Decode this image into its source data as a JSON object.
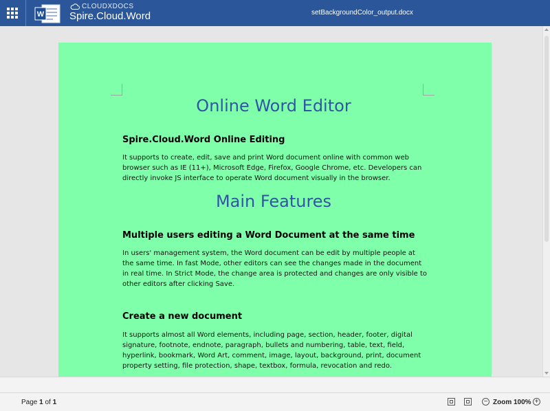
{
  "header": {
    "brand_top": "CLOUDXDOCS",
    "brand_main": "Spire.Cloud.Word",
    "file_name": "setBackgroundColor_output.docx",
    "bg_color": "#2b579a"
  },
  "page": {
    "background_color": "#80ffaa"
  },
  "document": {
    "title": "Online Word Editor",
    "section1_heading": "Spire.Cloud.Word Online Editing",
    "section1_text": "It supports to create, edit, save and print Word document online with common web browser such as IE (11+), Microsoft Edge, Firefox, Google Chrome, etc. Developers can directly invoke JS interface to operate Word document visually in the browser.",
    "features_title": "Main Features",
    "feature1_heading": "Multiple users editing a Word Document at the same time",
    "feature1_text": "In users' management system, the Word document can be edit by multiple people at the same time. In fast Mode, other editors can see the changes made in the document in real time. In Strict Mode, the change area is protected and changes are only visible to other editors after clicking Save.",
    "feature2_heading": "Create a new document",
    "feature2_text": "It supports almost all Word elements, including page, section, header, footer, digital signature, footnote, endnote, paragraph, bullets and numbering, table, text, field, hyperlink, bookmark, Word Art, comment, image, layout, background, print, document property setting, file protection, shape, textbox, formula, revocation and redo."
  },
  "status": {
    "page_label": "Page",
    "page_current": "1",
    "page_of": "of",
    "page_total": "1",
    "zoom_label": "Zoom 100%",
    "zoom_out_symbol": "−",
    "zoom_in_symbol": "+"
  }
}
